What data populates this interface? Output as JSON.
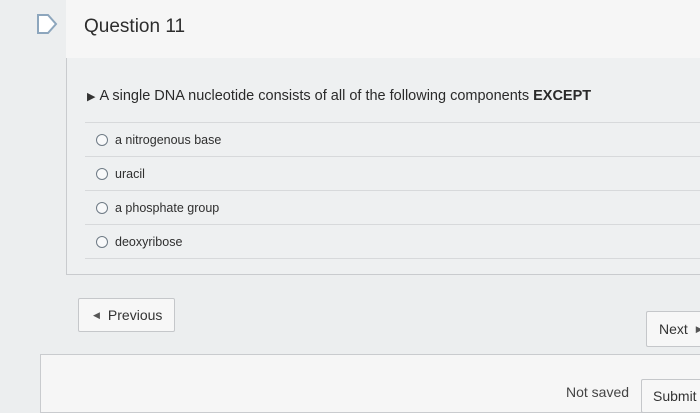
{
  "question": {
    "title": "Question 11",
    "text": "A single DNA nucleotide consists of all of the following components ",
    "text_emphasis": "EXCEPT",
    "answers": [
      {
        "label": "a nitrogenous base"
      },
      {
        "label": "uracil"
      },
      {
        "label": "a phosphate group"
      },
      {
        "label": "deoxyribose"
      }
    ]
  },
  "nav": {
    "previous_label": "Previous",
    "next_label": "Next"
  },
  "footer": {
    "status": "Not saved",
    "submit_label": "Submit"
  },
  "colors": {
    "background": "#eceeef",
    "header": "#f6f6f6",
    "radio_border": "#6f7b86"
  }
}
